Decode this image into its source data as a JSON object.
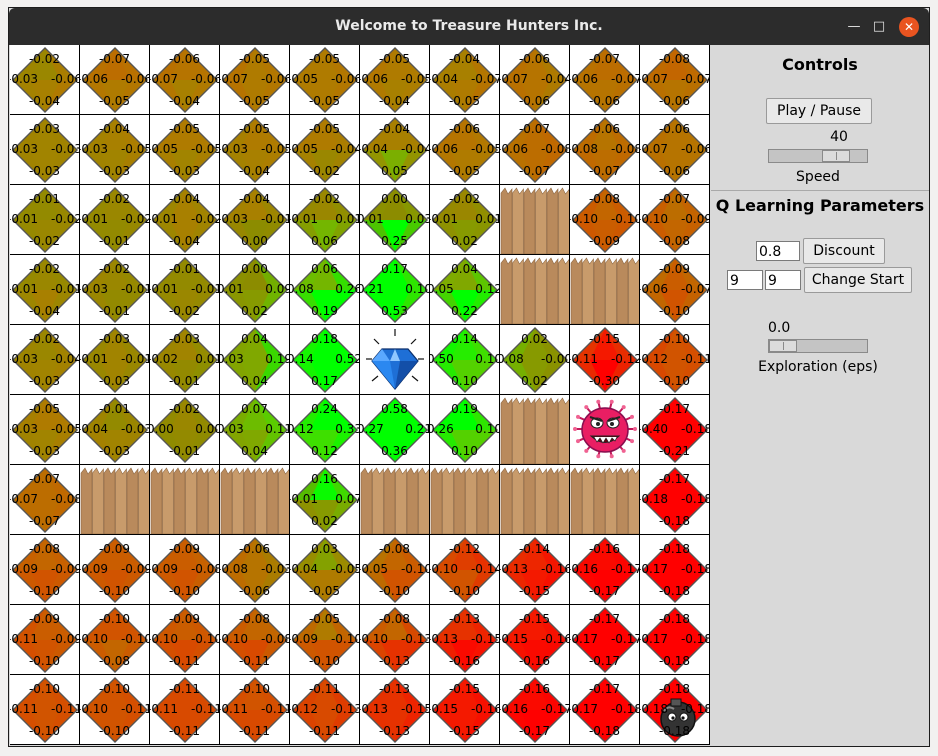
{
  "window": {
    "title": "Welcome to Treasure Hunters Inc."
  },
  "controls": {
    "heading": "Controls",
    "play_pause_label": "Play / Pause",
    "speed_value": "40",
    "speed_fraction": 0.76,
    "speed_label": "Speed"
  },
  "q_params": {
    "heading": "Q Learning Parameters",
    "discount_value": "0.8",
    "discount_label": "Discount",
    "start_row_value": "9",
    "start_col_value": "9",
    "change_start_label": "Change Start",
    "exploration_value": "0.0",
    "exploration_fraction": 0.0,
    "exploration_label": "Exploration (eps)"
  },
  "grid": {
    "rows": 10,
    "cols": 10,
    "cells": [
      [
        "q|-0.02|-0.06|-0.04|-0.03",
        "q|-0.07|-0.06|-0.05|-0.06",
        "q|-0.06|-0.06|-0.04|-0.07",
        "q|-0.05|-0.06|-0.05|-0.07",
        "q|-0.05|-0.06|-0.05|-0.05",
        "q|-0.05|-0.05|-0.04|-0.06",
        "q|-0.04|-0.07|-0.05|-0.04",
        "q|-0.06|-0.04|-0.06|-0.07",
        "q|-0.07|-0.07|-0.06|-0.06",
        "q|-0.08|-0.07|-0.06|-0.07"
      ],
      [
        "q|-0.03|-0.03|-0.03|-0.03",
        "q|-0.04|-0.05|-0.03|-0.03",
        "q|-0.05|-0.05|-0.03|-0.05",
        "q|-0.05|-0.05|-0.04|-0.03",
        "q|-0.05|-0.04|-0.02|-0.05",
        "q|-0.04|-0.04|0.05|-0.04",
        "q|-0.06|-0.05|-0.05|-0.06",
        "q|-0.07|-0.08|-0.07|-0.06",
        "q|-0.06|-0.08|-0.07|-0.08",
        "q|-0.06|-0.06|-0.06|-0.07"
      ],
      [
        "q|-0.01|-0.02|-0.02|-0.01",
        "q|-0.02|-0.02|-0.01|-0.01",
        "q|-0.04|-0.02|-0.04|-0.01",
        "q|-0.04|-0.01|0.00|-0.03",
        "q|-0.02|0.01|0.06|-0.01",
        "q|0.00|0.03|0.25|0.01",
        "q|-0.02|0.01|0.02|-0.01",
        "w",
        "q|-0.08|-0.10|-0.09|-0.10",
        "q|-0.07|-0.09|-0.08|-0.10"
      ],
      [
        "q|-0.02|-0.01|-0.04|-0.01",
        "q|-0.02|-0.01|-0.01|-0.03",
        "q|-0.01|-0.01|-0.02|-0.01",
        "q|0.00|0.09|0.02|0.01",
        "q|0.06|0.26|0.19|0.08",
        "q|0.17|0.10|0.53|0.21",
        "q|0.04|0.12|0.22|0.05",
        "w",
        "w",
        "q|-0.09|-0.07|-0.10|-0.06"
      ],
      [
        "q|-0.02|-0.04|-0.03|-0.03",
        "q|-0.03|-0.01|-0.03|-0.01",
        "q|-0.03|0.01|-0.01|-0.02",
        "q|0.04|0.19|0.04|0.03",
        "q|0.18|0.52|0.17|0.14",
        "t",
        "q|0.14|0.10|0.10|0.50",
        "q|0.02|-0.00|0.02|0.08",
        "q|-0.15|-0.12|-0.30|-0.11",
        "q|-0.10|-0.11|-0.10|-0.12"
      ],
      [
        "q|-0.05|-0.05|-0.03|-0.03",
        "q|-0.01|-0.03|-0.03|-0.04",
        "q|-0.02|0.00|-0.01|0.00",
        "q|0.07|0.11|0.04|0.03",
        "q|0.24|0.33|0.12|0.12",
        "q|0.58|0.21|0.36|0.27",
        "q|0.19|0.10|0.10|0.26",
        "w",
        "m",
        "q|-0.17|-0.18|-0.21|-0.40"
      ],
      [
        "q|-0.07|-0.08|-0.07|-0.07",
        "w",
        "w",
        "w",
        "q|0.16|0.07|0.02|-0.01",
        "w",
        "w",
        "w",
        "w",
        "q|-0.17|-0.18|-0.18|-0.18"
      ],
      [
        "q|-0.08|-0.09|-0.10|-0.09",
        "q|-0.09|-0.09|-0.10|-0.09",
        "q|-0.09|-0.08|-0.10|-0.09",
        "q|-0.06|-0.03|-0.06|-0.08",
        "q|0.03|-0.05|-0.05|-0.04",
        "q|-0.08|-0.10|-0.10|-0.05",
        "q|-0.12|-0.14|-0.10|-0.10",
        "q|-0.14|-0.16|-0.15|-0.13",
        "q|-0.16|-0.17|-0.17|-0.16",
        "q|-0.18|-0.18|-0.18|-0.17"
      ],
      [
        "q|-0.09|-0.09|-0.10|-0.11",
        "q|-0.10|-0.10|-0.08|-0.10",
        "q|-0.09|-0.10|-0.11|-0.10",
        "q|-0.08|-0.08|-0.11|-0.10",
        "q|-0.05|-0.10|-0.10|-0.09",
        "q|-0.08|-0.13|-0.13|-0.10",
        "q|-0.13|-0.15|-0.16|-0.13",
        "q|-0.15|-0.16|-0.16|-0.15",
        "q|-0.17|-0.17|-0.17|-0.17",
        "q|-0.18|-0.18|-0.18|-0.17"
      ],
      [
        "q|-0.10|-0.11|-0.10|-0.11",
        "q|-0.10|-0.11|-0.10|-0.10",
        "q|-0.11|-0.11|-0.11|-0.11",
        "q|-0.10|-0.11|-0.11|-0.11",
        "q|-0.11|-0.13|-0.11|-0.12",
        "q|-0.13|-0.15|-0.13|-0.13",
        "q|-0.15|-0.16|-0.15|-0.15",
        "q|-0.16|-0.17|-0.17|-0.16",
        "q|-0.17|-0.18|-0.18|-0.17",
        "b|-0.18|-0.18|-0.18|-0.18"
      ]
    ]
  },
  "icons": {
    "treasure": "diamond-icon",
    "monster": "monster-icon",
    "player": "bomb-icon",
    "wall": "fence-icon"
  },
  "colors": {
    "window_bg": "#d9d9d9",
    "titlebar": "#2c2c2c",
    "close_button": "#e95420",
    "q_low": "#ff0000",
    "q_mid": "#ffff00",
    "q_high": "#00ff00"
  }
}
